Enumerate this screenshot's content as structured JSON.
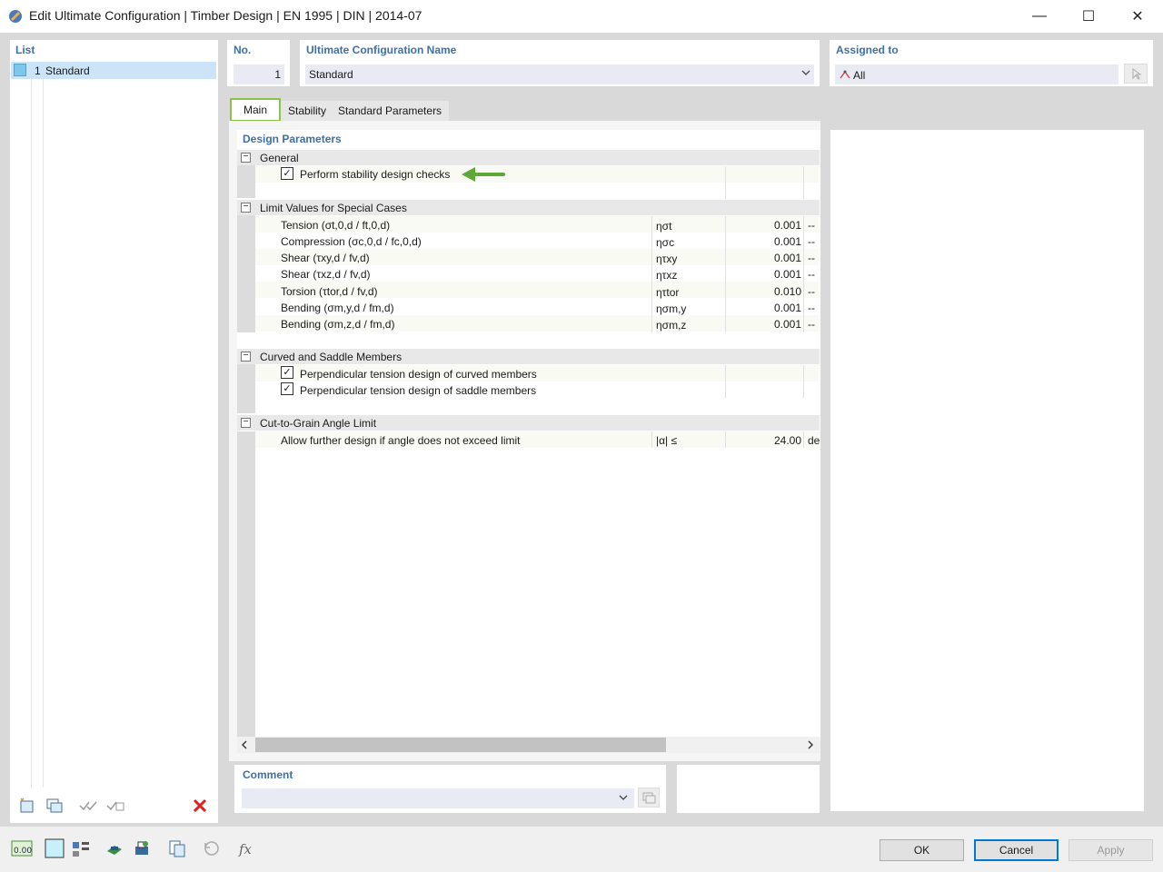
{
  "window": {
    "title": "Edit Ultimate Configuration | Timber Design | EN 1995 | DIN | 2014-07",
    "minimize": "—",
    "maximize": "☐",
    "close": "✕"
  },
  "list": {
    "title": "List",
    "items": [
      {
        "no": "1",
        "name": "Standard"
      }
    ]
  },
  "header": {
    "no_label": "No.",
    "no_value": "1",
    "name_label": "Ultimate Configuration Name",
    "name_value": "Standard",
    "assigned_label": "Assigned to",
    "assigned_value": "All"
  },
  "tabs": [
    {
      "label": "Main"
    },
    {
      "label": "Stability"
    },
    {
      "label": "Standard Parameters"
    }
  ],
  "design": {
    "title": "Design Parameters",
    "general": {
      "label": "General",
      "stability_check": "Perform stability design checks"
    },
    "limits": {
      "label": "Limit Values for Special Cases",
      "rows": [
        {
          "label": "Tension (σt,0,d / ft,0,d)",
          "symbol": "ησt",
          "value": "0.001",
          "unit": "--"
        },
        {
          "label": "Compression (σc,0,d / fc,0,d)",
          "symbol": "ησc",
          "value": "0.001",
          "unit": "--"
        },
        {
          "label": "Shear (τxy,d / fv,d)",
          "symbol": "ητxy",
          "value": "0.001",
          "unit": "--"
        },
        {
          "label": "Shear (τxz,d / fv,d)",
          "symbol": "ητxz",
          "value": "0.001",
          "unit": "--"
        },
        {
          "label": "Torsion (τtor,d / fv,d)",
          "symbol": "ητtor",
          "value": "0.010",
          "unit": "--"
        },
        {
          "label": "Bending (σm,y,d / fm,d)",
          "symbol": "ησm,y",
          "value": "0.001",
          "unit": "--"
        },
        {
          "label": "Bending (σm,z,d / fm,d)",
          "symbol": "ησm,z",
          "value": "0.001",
          "unit": "--"
        }
      ]
    },
    "curved": {
      "label": "Curved and Saddle Members",
      "curved_check": "Perpendicular tension design of curved members",
      "saddle_check": "Perpendicular tension design of saddle members"
    },
    "cut": {
      "label": "Cut-to-Grain Angle Limit",
      "row_label": "Allow further design if angle does not exceed limit",
      "symbol": "|α| ≤",
      "value": "24.00",
      "unit": "de"
    }
  },
  "comment": {
    "label": "Comment",
    "value": ""
  },
  "buttons": {
    "ok": "OK",
    "cancel": "Cancel",
    "apply": "Apply"
  },
  "colors": {
    "accent_header": "#3f6fa6",
    "tab_highlight": "#8ac34a",
    "arrow": "#5ea838",
    "delete": "#e02020"
  }
}
